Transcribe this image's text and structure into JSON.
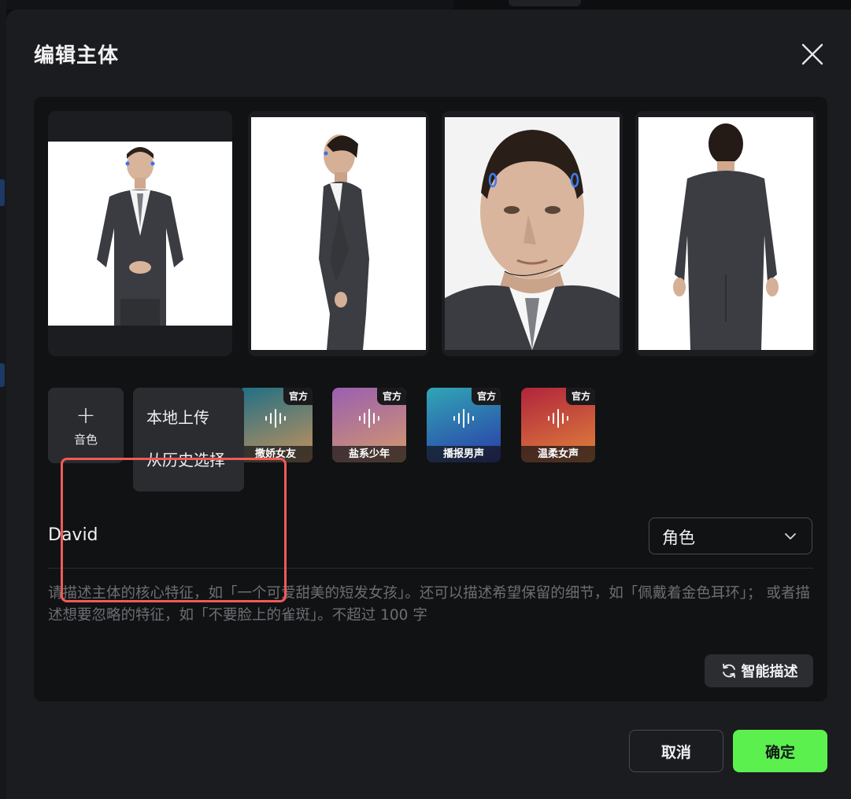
{
  "dialog": {
    "title": "编辑主体",
    "close_icon": "close-icon"
  },
  "images": [
    {
      "name": "front-view",
      "description_icon": "person-front"
    },
    {
      "name": "side-view",
      "description_icon": "person-side"
    },
    {
      "name": "face-closeup",
      "description_icon": "person-face"
    },
    {
      "name": "back-view",
      "description_icon": "person-back"
    }
  ],
  "voice": {
    "add_plus": "+",
    "add_label": "音色",
    "menu": {
      "upload_local": "本地上传",
      "from_history": "从历史选择"
    },
    "options": [
      {
        "name": "撒娇女友",
        "badge": "官方",
        "gradient": [
          "#1f6f86",
          "#c7925a"
        ]
      },
      {
        "name": "盐系少年",
        "badge": "官方",
        "gradient": [
          "#9a5fb0",
          "#d59a6a"
        ]
      },
      {
        "name": "播报男声",
        "badge": "官方",
        "gradient": [
          "#31a6b5",
          "#2a3aa8"
        ]
      },
      {
        "name": "温柔女声",
        "badge": "官方",
        "gradient": [
          "#b1243c",
          "#e0843c"
        ]
      }
    ]
  },
  "subject": {
    "name": "David",
    "role_value": "角色"
  },
  "description": {
    "placeholder": "请描述主体的核心特征，如「一个可爱甜美的短发女孩」。还可以描述希望保留的细节，如「佩戴着金色耳环」； 或者描述想要忽略的特征，如「不要脸上的雀斑」。不超过 100 字",
    "value": ""
  },
  "smart_describe": {
    "label": "智能描述",
    "icon": "refresh-icon"
  },
  "footer": {
    "cancel_label": "取消",
    "ok_label": "确定"
  },
  "colors": {
    "accent": "#5cf04f",
    "highlight": "#f25a55",
    "dialog_bg": "#1b1c1f",
    "panel_bg": "#111214"
  }
}
